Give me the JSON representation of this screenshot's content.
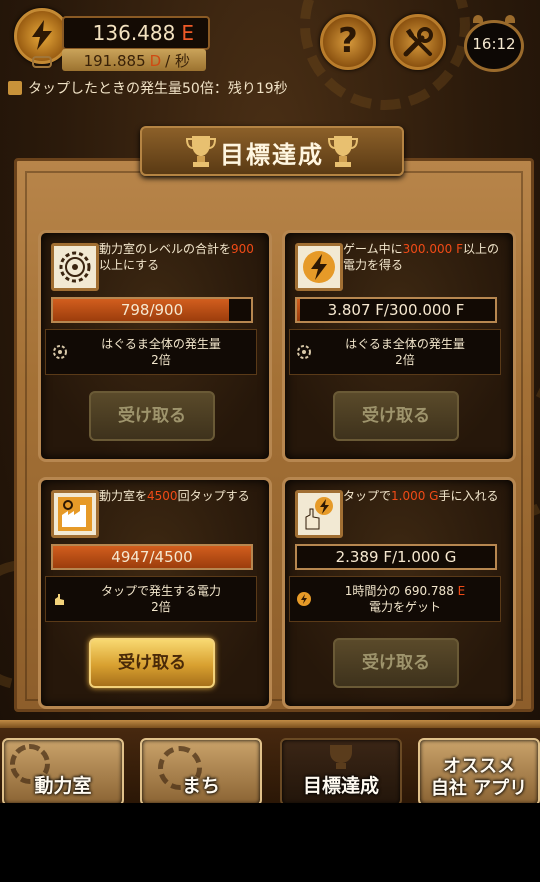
{
  "hud": {
    "energy_value": "136.488",
    "energy_unit": "E",
    "rate_value": "191.885",
    "rate_unit": "D",
    "rate_suffix": "/ 秒",
    "clock": "16:12",
    "bonus_text": "タップしたときの発生量50倍：残り19秒"
  },
  "title": "目標達成",
  "cards": [
    {
      "desc_a": "動力室のレベルの合計を",
      "desc_hl": "900",
      "desc_b": "以上にする",
      "progress_text": "798/900",
      "progress_fraction": 0.887,
      "reward_line1": "はぐるま全体の発生量",
      "reward_line2": "2倍",
      "claim_label": "受け取る",
      "claim_enabled": false,
      "icon": "gear-icon"
    },
    {
      "desc_a": "ゲーム中に",
      "desc_hl": "300.000 F",
      "desc_b": "以上の電力を得る",
      "progress_text": "3.807 F/300.000 F",
      "progress_fraction": 0.013,
      "reward_line1": "はぐるま全体の発生量",
      "reward_line2": "2倍",
      "claim_label": "受け取る",
      "claim_enabled": false,
      "icon": "lightning-icon"
    },
    {
      "desc_a": "動力室を",
      "desc_hl": "4500",
      "desc_b": "回タップする",
      "progress_text": "4947/4500",
      "progress_fraction": 1.0,
      "reward_line1": "タップで発生する電力",
      "reward_line2": "2倍",
      "claim_label": "受け取る",
      "claim_enabled": true,
      "icon": "tap-factory-icon"
    },
    {
      "desc_a": "タップで",
      "desc_hl": "1.000 G",
      "desc_b": "手に入れる",
      "progress_text": "2.389 F/1.000 G",
      "progress_fraction": 0.0,
      "reward_line1": "1時間分の 690.788",
      "reward_unit": "E",
      "reward_line2": "電力をゲット",
      "claim_label": "受け取る",
      "claim_enabled": false,
      "icon": "tap-energy-icon"
    }
  ],
  "nav": {
    "tab1": "動力室",
    "tab2": "まち",
    "tab3": "目標達成",
    "tab4_line1": "オススメ",
    "tab4_line2": "自社 アプリ"
  },
  "colors": {
    "accent_red": "#f04a16",
    "claim_active": "#d8a030",
    "panel_border": "#b78750"
  }
}
